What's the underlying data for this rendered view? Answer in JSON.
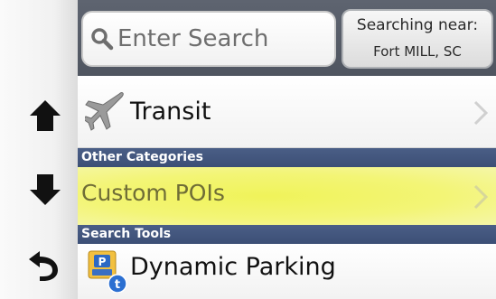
{
  "search": {
    "placeholder": "Enter Search",
    "near_label": "Searching near:",
    "near_location": "Fort MILL, SC"
  },
  "rail": {
    "up_icon": "up-arrow-icon",
    "down_icon": "down-arrow-icon",
    "back_icon": "back-arrow-icon"
  },
  "list": {
    "transit": {
      "label": "Transit",
      "icon": "airplane-icon"
    },
    "section_other": "Other Categories",
    "custom_pois": {
      "label": "Custom POIs",
      "highlighted": true
    },
    "section_tools": "Search Tools",
    "dynamic_parking": {
      "label": "Dynamic Parking",
      "icon": "parking-icon"
    }
  },
  "colors": {
    "header_bg": "#555b66",
    "section_bg": "#43567e",
    "highlight": "#f0f35a",
    "row_bg": "#ffffff"
  }
}
